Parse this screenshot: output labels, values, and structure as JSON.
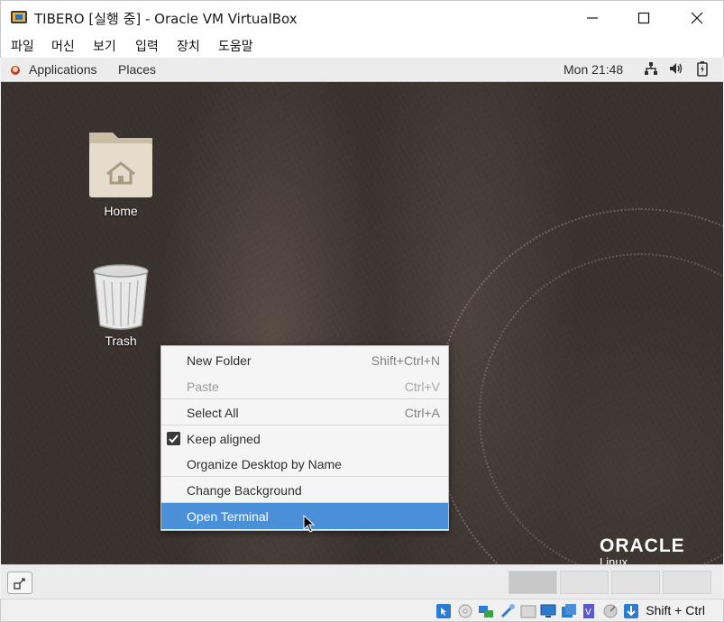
{
  "window": {
    "title": "TIBERO [실행 중] - Oracle VM VirtualBox",
    "icon": "virtualbox-icon",
    "controls": [
      "minimize",
      "maximize",
      "close"
    ]
  },
  "menubar": {
    "items": [
      "파일",
      "머신",
      "보기",
      "입력",
      "장치",
      "도움말"
    ]
  },
  "gnome_topbar": {
    "applications": "Applications",
    "places": "Places",
    "clock": "Mon 21:48",
    "status_icons": [
      "network-icon",
      "volume-icon",
      "battery-icon"
    ]
  },
  "desktop": {
    "icons": [
      {
        "label": "Home",
        "icon": "home-folder-icon"
      },
      {
        "label": "Trash",
        "icon": "trash-icon"
      }
    ],
    "watermark": {
      "brand": "ORACLE",
      "sub": "Linux"
    }
  },
  "context_menu": {
    "items": [
      {
        "label": "New Folder",
        "accel": "Shift+Ctrl+N",
        "enabled": true
      },
      {
        "label": "Paste",
        "accel": "Ctrl+V",
        "enabled": false
      },
      {
        "label": "Select All",
        "accel": "Ctrl+A",
        "enabled": true
      },
      {
        "label": "Keep aligned",
        "accel": "",
        "enabled": true,
        "checked": true
      },
      {
        "label": "Organize Desktop by Name",
        "accel": "",
        "enabled": true
      },
      {
        "label": "Change Background",
        "accel": "",
        "enabled": true
      },
      {
        "label": "Open Terminal",
        "accel": "",
        "enabled": true,
        "selected": true
      }
    ]
  },
  "bottom_panel": {
    "workspaces": 4,
    "active_workspace": 1
  },
  "vbox_status": {
    "icons": [
      "mouse-integration-icon",
      "optical-drive-icon",
      "network-adapter-icon",
      "usb-icon",
      "shared-folders-icon",
      "display-icon",
      "recording-icon",
      "cpu-vt-icon",
      "audio-icon",
      "keyboard-capture-icon"
    ],
    "host_key": "Shift + Ctrl"
  },
  "colors": {
    "selection": "#4a90d9",
    "desktop_bg": "#3a322e",
    "panel_bg": "#ececec"
  }
}
